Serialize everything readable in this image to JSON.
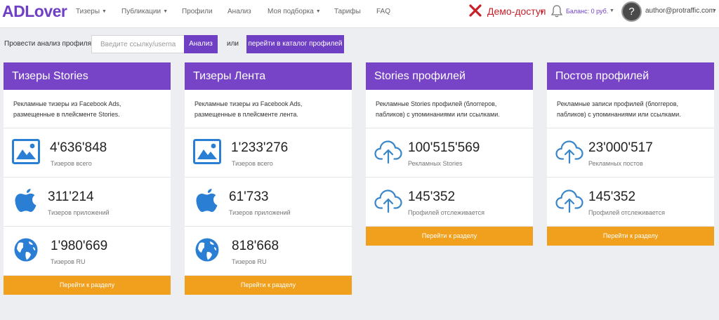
{
  "nav": {
    "logo": "ADLover",
    "items": [
      {
        "label": "Тизеры",
        "caret": true
      },
      {
        "label": "Публикации",
        "caret": true
      },
      {
        "label": "Профили",
        "caret": false
      },
      {
        "label": "Анализ",
        "caret": false
      },
      {
        "label": "Моя подборка",
        "caret": true
      },
      {
        "label": "Тарифы",
        "caret": false
      },
      {
        "label": "FAQ",
        "caret": false
      }
    ],
    "demo": "Демо-доступ",
    "balance": "Баланс: 0 руб.",
    "avatar": "?",
    "user": "author@protraffic.com"
  },
  "analysis": {
    "label": "Провести анализ профиля",
    "placeholder": "Введите ссылку/username",
    "button": "Анализ",
    "or": "или",
    "catalog_button": "перейти в каталог профилей"
  },
  "cards": [
    {
      "title": "Тизеры Stories",
      "desc": "Рекламные тизеры из Facebook Ads, размещенные в плейсменте Stories.",
      "stats": [
        {
          "icon": "image-icon",
          "value": "4'636'848",
          "label": "Тизеров всего"
        },
        {
          "icon": "apple-icon",
          "value": "311'214",
          "label": "Тизеров приложений"
        },
        {
          "icon": "globe-icon",
          "value": "1'980'669",
          "label": "Тизеров RU"
        }
      ],
      "button": "Перейти к разделу"
    },
    {
      "title": "Тизеры Лента",
      "desc": "Рекламные тизеры из Facebook Ads, размещенные в плейсменте лента.",
      "stats": [
        {
          "icon": "image-icon",
          "value": "1'233'276",
          "label": "Тизеров всего"
        },
        {
          "icon": "apple-icon",
          "value": "61'733",
          "label": "Тизеров приложений"
        },
        {
          "icon": "globe-icon",
          "value": "818'668",
          "label": "Тизеров RU"
        }
      ],
      "button": "Перейти к разделу"
    },
    {
      "title": "Stories профилей",
      "desc": "Рекламные Stories профилей (блоггеров, пабликов) с упоминаниями или ссылками.",
      "stats": [
        {
          "icon": "cloud-upload-icon",
          "value": "100'515'569",
          "label": "Рекламных Stories"
        },
        {
          "icon": "cloud-upload-icon",
          "value": "145'352",
          "label": "Профилей отслеживается"
        }
      ],
      "button": "Перейти к разделу"
    },
    {
      "title": "Постов профилей",
      "desc": "Рекламные записи профилей (блоггеров, пабликов) с упоминаниями или ссылками.",
      "stats": [
        {
          "icon": "cloud-upload-icon",
          "value": "23'000'517",
          "label": "Рекламных постов"
        },
        {
          "icon": "cloud-upload-icon",
          "value": "145'352",
          "label": "Профилей отслеживается"
        }
      ],
      "button": "Перейти к разделу"
    }
  ],
  "colors": {
    "accent": "#7744c8",
    "button": "#f1a01d",
    "icon_blue": "#2a7ed3",
    "cloud_blue": "#3a86c8",
    "demo_red": "#c8202a"
  }
}
